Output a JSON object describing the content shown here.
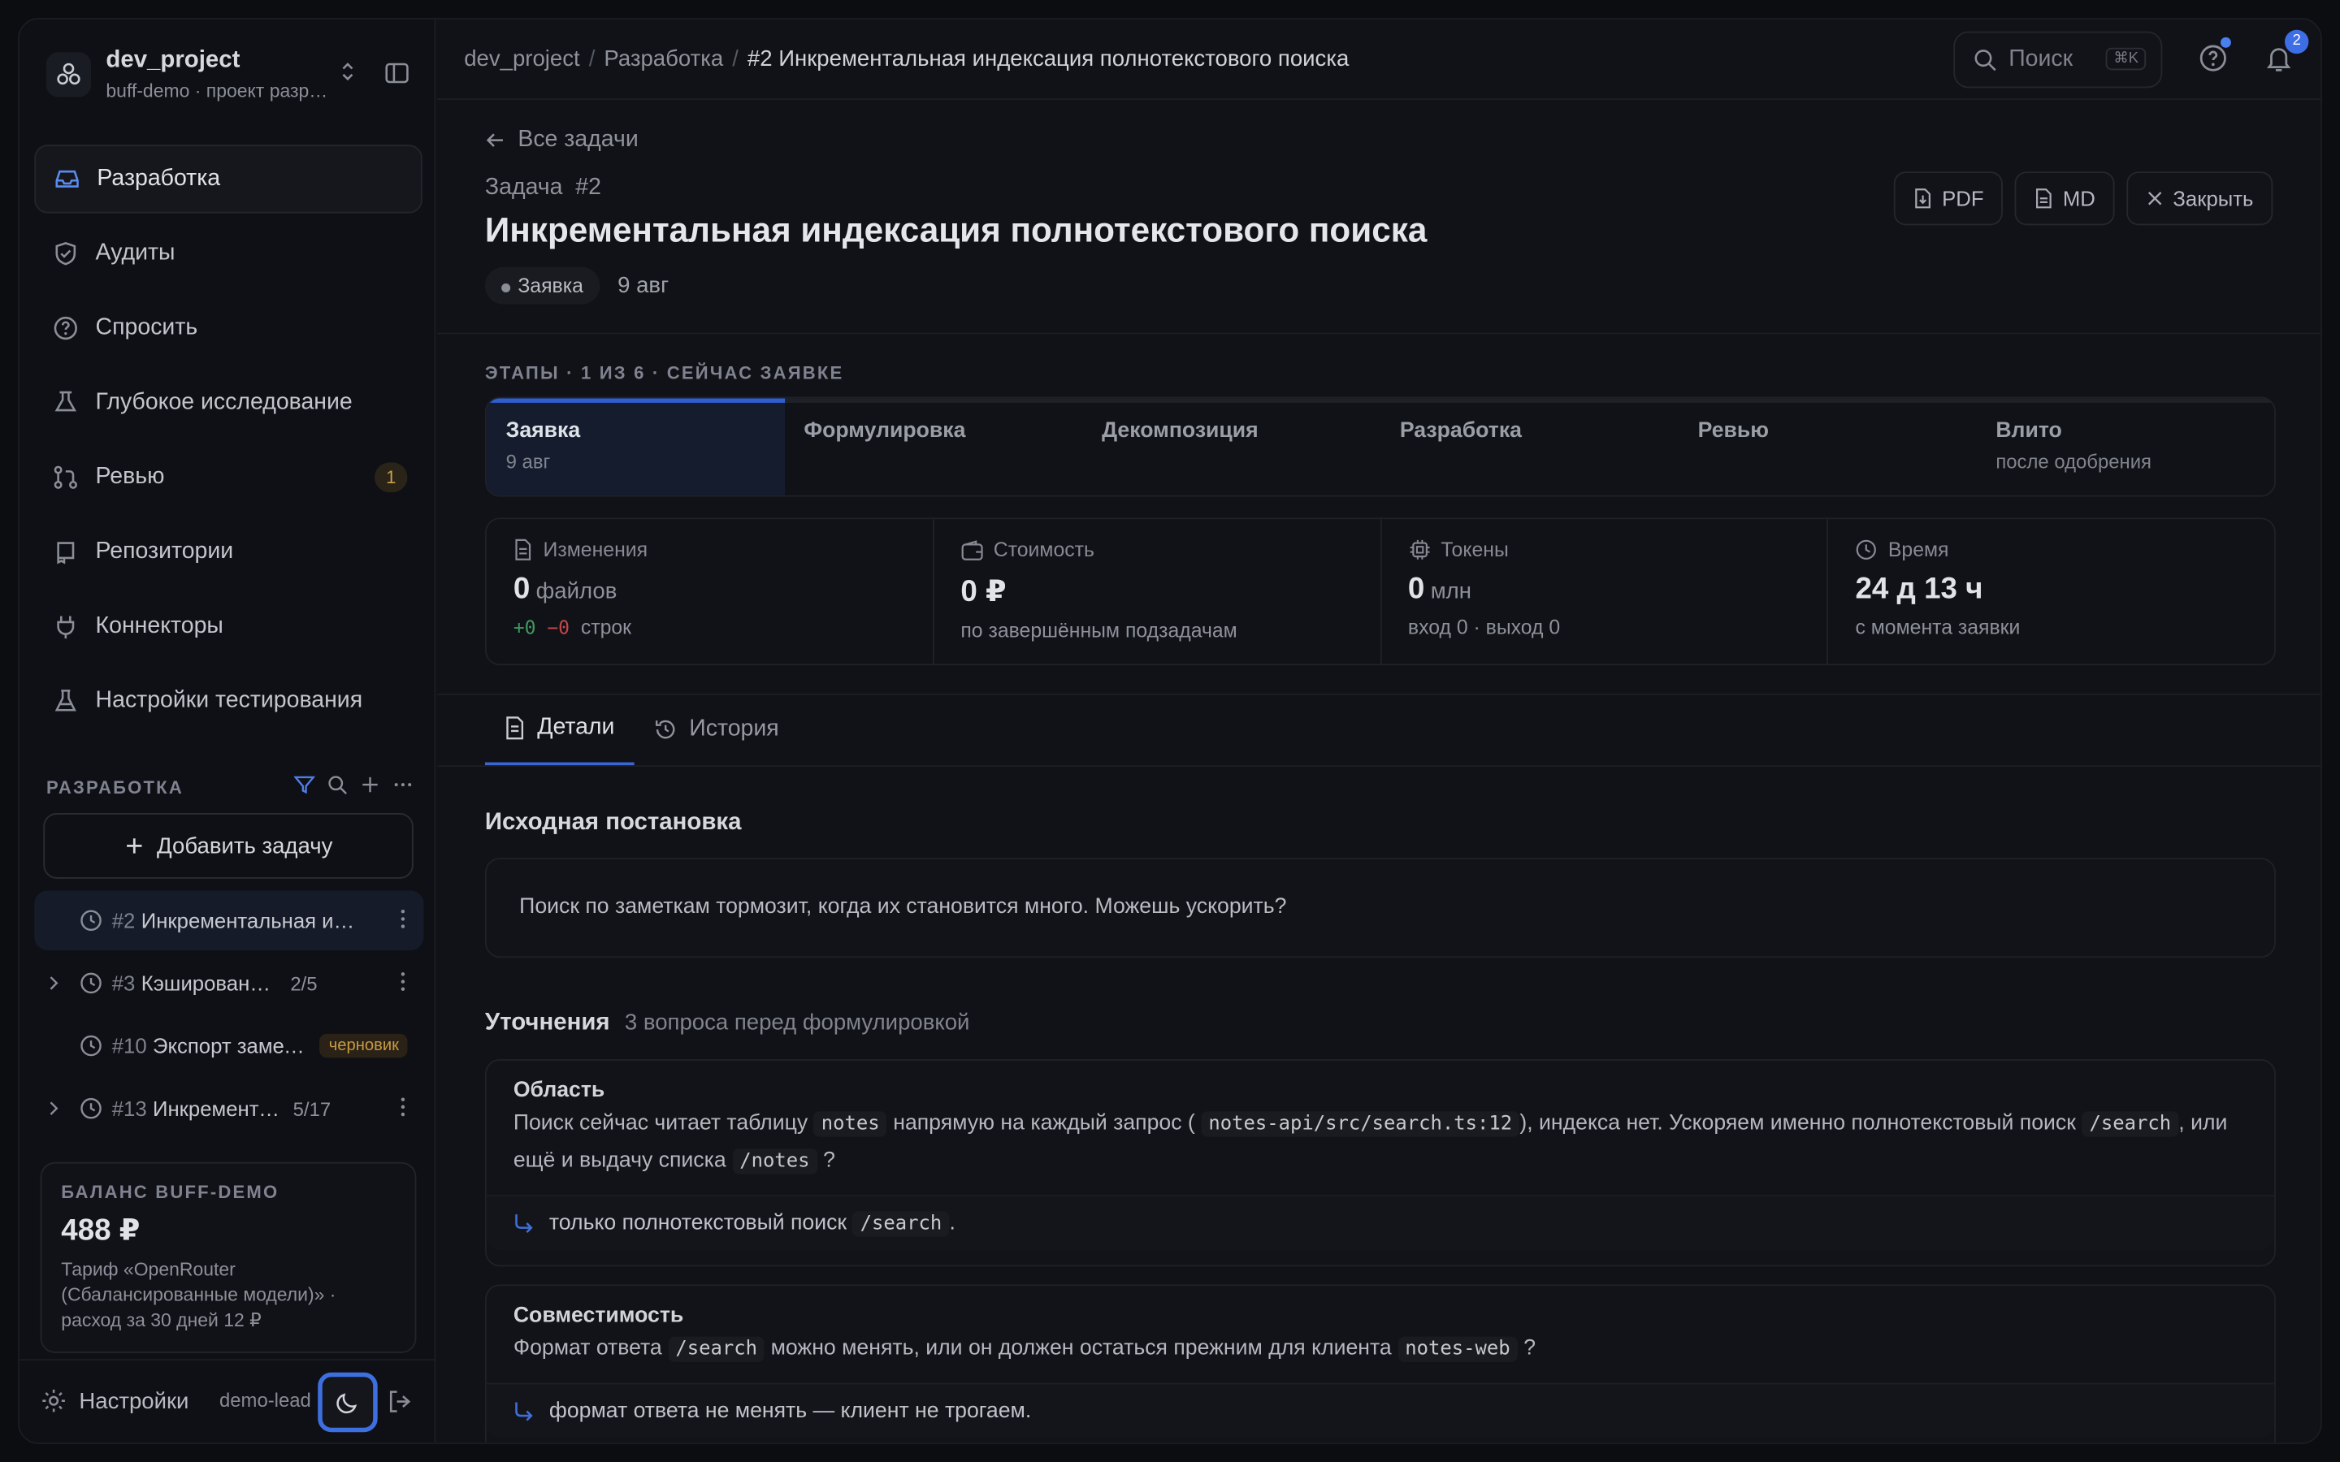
{
  "sidebar": {
    "project_name": "dev_project",
    "project_sub": "buff-demo · проект разработки",
    "nav": [
      {
        "label": "Разработка",
        "icon": "inbox-icon"
      },
      {
        "label": "Аудиты",
        "icon": "shield-icon"
      },
      {
        "label": "Спросить",
        "icon": "question-icon"
      },
      {
        "label": "Глубокое исследование",
        "icon": "flask-search-icon"
      },
      {
        "label": "Ревью",
        "icon": "git-pull-request-icon",
        "badge": "1"
      },
      {
        "label": "Репозитории",
        "icon": "repo-icon"
      },
      {
        "label": "Коннекторы",
        "icon": "plug-icon"
      },
      {
        "label": "Настройки тестирования",
        "icon": "beaker-icon"
      }
    ],
    "section_title": "РАЗРАБОТКА",
    "add_task": "Добавить задачу",
    "tasks": [
      {
        "num": "#2",
        "title": "Инкрементальная индексация полнотекстового поиска",
        "count": ""
      },
      {
        "num": "#3",
        "title": "Кэширование ответов",
        "count": "2/5"
      },
      {
        "num": "#10",
        "title": "Экспорт заметок",
        "draft": "черновик"
      },
      {
        "num": "#13",
        "title": "Инкрементальная индексация",
        "count": "5/17"
      }
    ],
    "balance": {
      "label": "БАЛАНС BUFF-DEMO",
      "amount": "488 ₽",
      "desc": "Тариф «OpenRouter (Сбалансированные модели)» · расход за 30 дней 12 ₽"
    },
    "footer": {
      "settings": "Настройки",
      "user": "demo-lead"
    }
  },
  "topbar": {
    "crumbs": [
      "dev_project",
      "Разработка",
      "#2 Инкрементальная индексация полнотекстового поиска"
    ],
    "search_label": "Поиск",
    "search_kbd": "⌘K",
    "notifications": "2"
  },
  "task": {
    "back": "Все задачи",
    "label": "Задача",
    "number": "#2",
    "title": "Инкрементальная индексация полнотекстового поиска",
    "status": "Заявка",
    "date": "9 авг",
    "actions": {
      "pdf": "PDF",
      "md": "MD",
      "close": "Закрыть"
    }
  },
  "stages": {
    "label": "ЭТАПЫ · 1 ИЗ 6 · СЕЙЧАС ЗАЯВКЕ",
    "items": [
      {
        "name": "Заявка",
        "sub": "9 авг"
      },
      {
        "name": "Формулировка",
        "sub": ""
      },
      {
        "name": "Декомпозиция",
        "sub": ""
      },
      {
        "name": "Разработка",
        "sub": ""
      },
      {
        "name": "Ревью",
        "sub": ""
      },
      {
        "name": "Влито",
        "sub": "после одобрения"
      }
    ]
  },
  "metrics": [
    {
      "title": "Изменения",
      "value": "0",
      "unit": "файлов",
      "plus": "+0",
      "minus": "−0",
      "foot": "строк",
      "icon": "file-icon"
    },
    {
      "title": "Стоимость",
      "value": "0 ₽",
      "unit": "",
      "foot": "по завершённым подзадачам",
      "icon": "wallet-icon"
    },
    {
      "title": "Токены",
      "value": "0",
      "unit": "млн",
      "foot": "вход 0 · выход 0",
      "icon": "cpu-icon"
    },
    {
      "title": "Время",
      "value": "24 д 13 ч",
      "unit": "",
      "foot": "с момента заявки",
      "icon": "clock-icon"
    }
  ],
  "tabs": [
    {
      "label": "Детали",
      "icon": "doc-icon"
    },
    {
      "label": "История",
      "icon": "history-icon"
    }
  ],
  "original": {
    "heading": "Исходная постановка",
    "text": "Поиск по заметкам тормозит, когда их становится много. Можешь ускорить?"
  },
  "clarifications": {
    "heading": "Уточнения",
    "sub": "3 вопроса перед формулировкой",
    "items": [
      {
        "title": "Область",
        "t1": "Поиск сейчас читает таблицу",
        "c1": "notes",
        "t2": "напрямую на каждый запрос (",
        "c2": "notes-api/src/search.ts:12",
        "t3": "), индекса нет. Ускоряем именно полнотекстовый поиск",
        "c3": "/search",
        "t4": ", или ещё и выдачу списка",
        "c4": "/notes",
        "t5": "?",
        "answer_text": "только полнотекстовый поиск",
        "answer_code": "/search",
        "answer_end": "."
      },
      {
        "title": "Совместимость",
        "t1": "Формат ответа",
        "c1": "/search",
        "t2": "можно менять, или он должен остаться прежним для клиента",
        "c2": "notes-web",
        "t3": "?",
        "answer_text": "формат ответа не менять — клиент не трогаем."
      }
    ]
  }
}
